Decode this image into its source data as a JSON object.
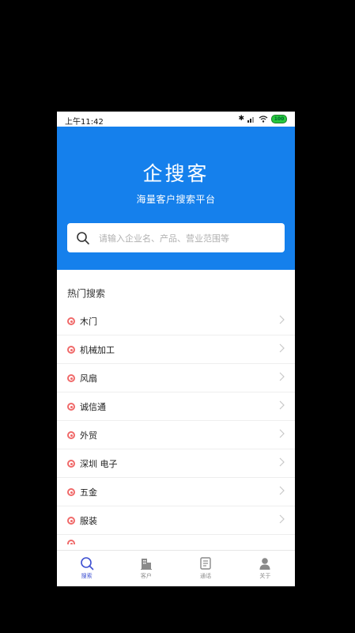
{
  "status_bar": {
    "time": "上午11:42",
    "battery": "100"
  },
  "hero": {
    "title": "企搜客",
    "subtitle": "海量客户搜索平台"
  },
  "search": {
    "placeholder": "请输入企业名、产品、营业范围等"
  },
  "hot": {
    "title": "热门搜索",
    "items": [
      {
        "label": "木门"
      },
      {
        "label": "机械加工"
      },
      {
        "label": "风扇"
      },
      {
        "label": "诚信通"
      },
      {
        "label": "外贸"
      },
      {
        "label": "深圳 电子"
      },
      {
        "label": "五金"
      },
      {
        "label": "服装"
      }
    ]
  },
  "tabs": [
    {
      "label": "搜索",
      "icon": "search-icon",
      "active": true
    },
    {
      "label": "客户",
      "icon": "building-icon",
      "active": false
    },
    {
      "label": "通话",
      "icon": "call-log-icon",
      "active": false
    },
    {
      "label": "关于",
      "icon": "person-icon",
      "active": false
    }
  ],
  "colors": {
    "hero_blue": "#1580ec",
    "accent": "#3d4fd1",
    "dot": "#f06a6a"
  }
}
